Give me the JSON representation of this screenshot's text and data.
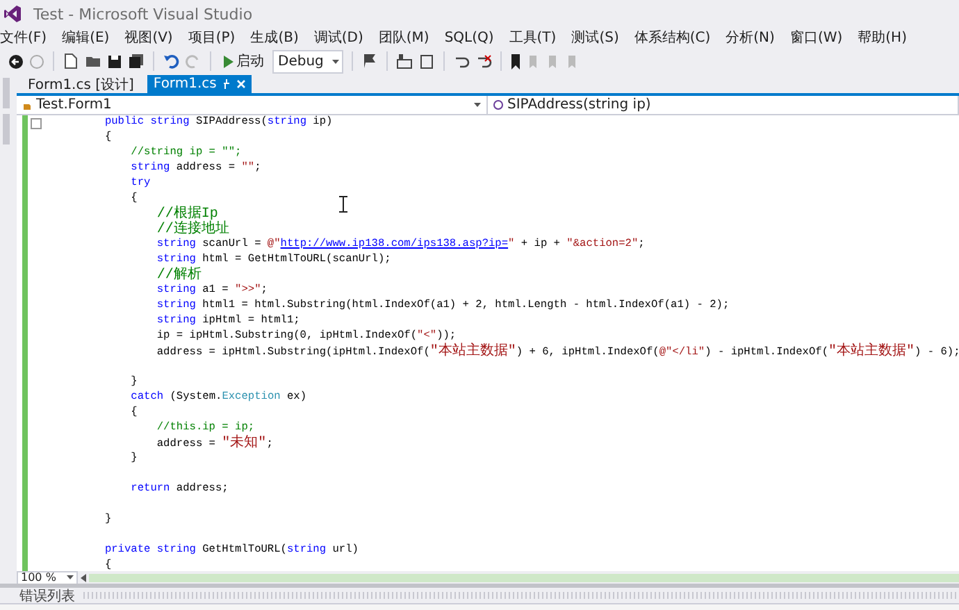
{
  "window": {
    "title": "Test - Microsoft Visual Studio"
  },
  "menu": [
    "文件(F)",
    "编辑(E)",
    "视图(V)",
    "项目(P)",
    "生成(B)",
    "调试(D)",
    "团队(M)",
    "SQL(Q)",
    "工具(T)",
    "测试(S)",
    "体系结构(C)",
    "分析(N)",
    "窗口(W)",
    "帮助(H)"
  ],
  "toolbar": {
    "start_button": "启动",
    "config_dropdown": "Debug"
  },
  "tabs": [
    {
      "label": "Form1.cs [设计]",
      "selected": false
    },
    {
      "label": "Form1.cs",
      "selected": true
    }
  ],
  "nav_bar": {
    "type_dropdown": "Test.Form1",
    "member_dropdown": "SIPAddress(string ip)"
  },
  "code_lines": [
    {
      "kind": "code",
      "segments": [
        {
          "kind": "keyword",
          "text": "public string"
        },
        {
          "kind": "plain",
          "text": " SIPAddress("
        },
        {
          "kind": "keyword",
          "text": "string"
        },
        {
          "kind": "plain",
          "text": " ip)"
        }
      ]
    },
    {
      "kind": "code",
      "segments": [
        {
          "kind": "plain",
          "text": "{"
        }
      ],
      "children": [
        {
          "kind": "code",
          "segments": [
            {
              "kind": "comment",
              "text": "//string ip = \"\";"
            }
          ]
        },
        {
          "kind": "code",
          "segments": [
            {
              "kind": "keyword",
              "text": "string"
            },
            {
              "kind": "plain",
              "text": " address = "
            },
            {
              "kind": "string",
              "text": "\"\""
            },
            {
              "kind": "plain",
              "text": ";"
            }
          ]
        },
        {
          "kind": "code",
          "segments": [
            {
              "kind": "keyword",
              "text": "try"
            }
          ]
        },
        {
          "kind": "code",
          "segments": [
            {
              "kind": "plain",
              "text": "{"
            }
          ],
          "children": [
            {
              "kind": "code",
              "segments": [
                {
                  "kind": "comment",
                  "text": "//根据Ip"
                }
              ]
            },
            {
              "kind": "code",
              "segments": [
                {
                  "kind": "comment",
                  "text": "//连接地址"
                }
              ]
            },
            {
              "kind": "code",
              "segments": [
                {
                  "kind": "keyword",
                  "text": "string"
                },
                {
                  "kind": "plain",
                  "text": " scanUrl = "
                },
                {
                  "kind": "string",
                  "text": "@\""
                },
                {
                  "kind": "link",
                  "text": "http://www.ip138.com/ips138.asp?ip="
                },
                {
                  "kind": "string",
                  "text": "\""
                },
                {
                  "kind": "plain",
                  "text": " + ip + "
                },
                {
                  "kind": "string",
                  "text": "\"&action=2\""
                },
                {
                  "kind": "plain",
                  "text": ";"
                }
              ]
            },
            {
              "kind": "code",
              "segments": [
                {
                  "kind": "keyword",
                  "text": "string"
                },
                {
                  "kind": "plain",
                  "text": " html = GetHtmlToURL(scanUrl);"
                }
              ]
            },
            {
              "kind": "code",
              "segments": [
                {
                  "kind": "comment",
                  "text": "//解析"
                }
              ]
            },
            {
              "kind": "code",
              "segments": [
                {
                  "kind": "keyword",
                  "text": "string"
                },
                {
                  "kind": "plain",
                  "text": " a1 = "
                },
                {
                  "kind": "string",
                  "text": "\">>\""
                },
                {
                  "kind": "plain",
                  "text": ";"
                }
              ]
            },
            {
              "kind": "code",
              "segments": [
                {
                  "kind": "keyword",
                  "text": "string"
                },
                {
                  "kind": "plain",
                  "text": " html1 = html.Substring(html.IndexOf(a1) + 2, html.Length - html.IndexOf(a1) - 2);"
                }
              ]
            },
            {
              "kind": "code",
              "segments": [
                {
                  "kind": "keyword",
                  "text": "string"
                },
                {
                  "kind": "plain",
                  "text": " ipHtml = html1;"
                }
              ]
            },
            {
              "kind": "code",
              "segments": [
                {
                  "kind": "plain",
                  "text": "ip = ipHtml.Substring(0, ipHtml.IndexOf("
                },
                {
                  "kind": "string",
                  "text": "\"<\""
                },
                {
                  "kind": "plain",
                  "text": "));"
                }
              ]
            },
            {
              "kind": "code",
              "segments": [
                {
                  "kind": "plain",
                  "text": "address = ipHtml.Substring(ipHtml.IndexOf("
                },
                {
                  "kind": "string",
                  "text": "\"本站主数据\""
                },
                {
                  "kind": "plain",
                  "text": ") + 6, ipHtml.IndexOf("
                },
                {
                  "kind": "string",
                  "text": "@\"</li\""
                },
                {
                  "kind": "plain",
                  "text": ") - ipHtml.IndexOf("
                },
                {
                  "kind": "string",
                  "text": "\"本站主数据\""
                },
                {
                  "kind": "plain",
                  "text": ") - 6);"
                }
              ]
            },
            {
              "kind": "blank"
            }
          ]
        },
        {
          "kind": "code",
          "segments": [
            {
              "kind": "plain",
              "text": "}"
            }
          ]
        },
        {
          "kind": "code",
          "segments": [
            {
              "kind": "keyword",
              "text": "catch"
            },
            {
              "kind": "plain",
              "text": " (System."
            },
            {
              "kind": "type",
              "text": "Exception"
            },
            {
              "kind": "plain",
              "text": " ex)"
            }
          ]
        },
        {
          "kind": "code",
          "segments": [
            {
              "kind": "plain",
              "text": "{"
            }
          ],
          "children": [
            {
              "kind": "code",
              "segments": [
                {
                  "kind": "comment",
                  "text": "//this.ip = ip;"
                }
              ]
            },
            {
              "kind": "code",
              "segments": [
                {
                  "kind": "plain",
                  "text": "address = "
                },
                {
                  "kind": "string",
                  "text": "\"未知\""
                },
                {
                  "kind": "plain",
                  "text": ";"
                }
              ]
            }
          ]
        },
        {
          "kind": "code",
          "segments": [
            {
              "kind": "plain",
              "text": "}"
            }
          ]
        },
        {
          "kind": "blank"
        },
        {
          "kind": "code",
          "segments": [
            {
              "kind": "keyword",
              "text": "return"
            },
            {
              "kind": "plain",
              "text": " address;"
            }
          ]
        },
        {
          "kind": "blank"
        }
      ]
    },
    {
      "kind": "code",
      "segments": [
        {
          "kind": "plain",
          "text": "}"
        }
      ]
    },
    {
      "kind": "blank"
    },
    {
      "kind": "code",
      "segments": [
        {
          "kind": "keyword",
          "text": "private string"
        },
        {
          "kind": "plain",
          "text": " GetHtmlToURL("
        },
        {
          "kind": "keyword",
          "text": "string"
        },
        {
          "kind": "plain",
          "text": " url)"
        }
      ]
    },
    {
      "kind": "code",
      "segments": [
        {
          "kind": "plain",
          "text": "{"
        }
      ]
    }
  ],
  "zoom_dropdown": "100 %",
  "bottom_panel": {
    "title": "错误列表"
  }
}
